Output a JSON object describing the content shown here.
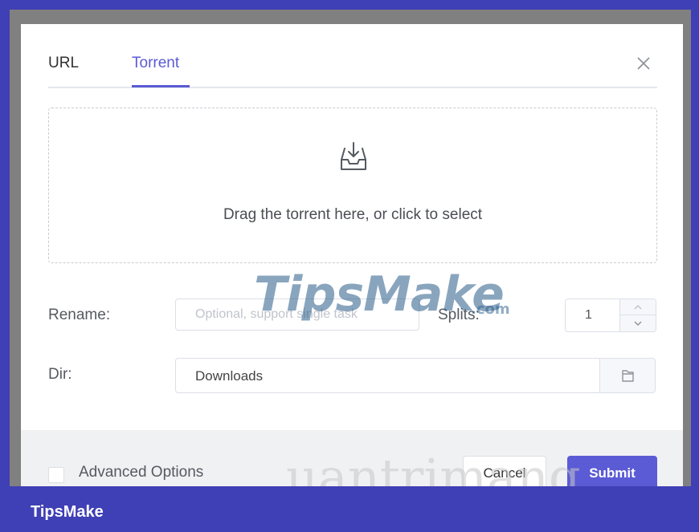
{
  "tabs": [
    {
      "label": "URL"
    },
    {
      "label": "Torrent"
    }
  ],
  "active_tab": "Torrent",
  "drop_zone": {
    "text": "Drag the torrent here, or click to select",
    "icon": "inbox-download-icon"
  },
  "form": {
    "rename_label": "Rename:",
    "rename_placeholder": "Optional, support single task",
    "splits_label": "Splits:",
    "splits_value": "1",
    "dir_label": "Dir:",
    "dir_value": "Downloads"
  },
  "footer": {
    "advanced_options_label": "Advanced Options",
    "cancel_label": "Cancel",
    "submit_label": "Submit"
  },
  "watermarks": {
    "primary": "TipsMake",
    "primary_suffix": ".com",
    "secondary": "uantrimang"
  },
  "brand": {
    "label": "TipsMake"
  },
  "colors": {
    "accent": "#5b5bd6",
    "brand_bar": "#3f3fb6",
    "footer_bg": "#f0f1f3"
  }
}
